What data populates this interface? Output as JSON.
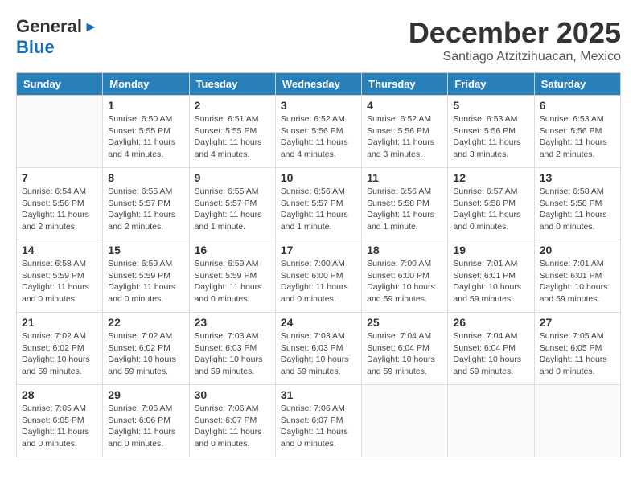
{
  "logo": {
    "general": "General",
    "blue": "Blue"
  },
  "title": {
    "month": "December 2025",
    "location": "Santiago Atzitzihuacan, Mexico"
  },
  "headers": [
    "Sunday",
    "Monday",
    "Tuesday",
    "Wednesday",
    "Thursday",
    "Friday",
    "Saturday"
  ],
  "weeks": [
    [
      {
        "day": "",
        "info": ""
      },
      {
        "day": "1",
        "info": "Sunrise: 6:50 AM\nSunset: 5:55 PM\nDaylight: 11 hours\nand 4 minutes."
      },
      {
        "day": "2",
        "info": "Sunrise: 6:51 AM\nSunset: 5:55 PM\nDaylight: 11 hours\nand 4 minutes."
      },
      {
        "day": "3",
        "info": "Sunrise: 6:52 AM\nSunset: 5:56 PM\nDaylight: 11 hours\nand 4 minutes."
      },
      {
        "day": "4",
        "info": "Sunrise: 6:52 AM\nSunset: 5:56 PM\nDaylight: 11 hours\nand 3 minutes."
      },
      {
        "day": "5",
        "info": "Sunrise: 6:53 AM\nSunset: 5:56 PM\nDaylight: 11 hours\nand 3 minutes."
      },
      {
        "day": "6",
        "info": "Sunrise: 6:53 AM\nSunset: 5:56 PM\nDaylight: 11 hours\nand 2 minutes."
      }
    ],
    [
      {
        "day": "7",
        "info": "Sunrise: 6:54 AM\nSunset: 5:56 PM\nDaylight: 11 hours\nand 2 minutes."
      },
      {
        "day": "8",
        "info": "Sunrise: 6:55 AM\nSunset: 5:57 PM\nDaylight: 11 hours\nand 2 minutes."
      },
      {
        "day": "9",
        "info": "Sunrise: 6:55 AM\nSunset: 5:57 PM\nDaylight: 11 hours\nand 1 minute."
      },
      {
        "day": "10",
        "info": "Sunrise: 6:56 AM\nSunset: 5:57 PM\nDaylight: 11 hours\nand 1 minute."
      },
      {
        "day": "11",
        "info": "Sunrise: 6:56 AM\nSunset: 5:58 PM\nDaylight: 11 hours\nand 1 minute."
      },
      {
        "day": "12",
        "info": "Sunrise: 6:57 AM\nSunset: 5:58 PM\nDaylight: 11 hours\nand 0 minutes."
      },
      {
        "day": "13",
        "info": "Sunrise: 6:58 AM\nSunset: 5:58 PM\nDaylight: 11 hours\nand 0 minutes."
      }
    ],
    [
      {
        "day": "14",
        "info": "Sunrise: 6:58 AM\nSunset: 5:59 PM\nDaylight: 11 hours\nand 0 minutes."
      },
      {
        "day": "15",
        "info": "Sunrise: 6:59 AM\nSunset: 5:59 PM\nDaylight: 11 hours\nand 0 minutes."
      },
      {
        "day": "16",
        "info": "Sunrise: 6:59 AM\nSunset: 5:59 PM\nDaylight: 11 hours\nand 0 minutes."
      },
      {
        "day": "17",
        "info": "Sunrise: 7:00 AM\nSunset: 6:00 PM\nDaylight: 11 hours\nand 0 minutes."
      },
      {
        "day": "18",
        "info": "Sunrise: 7:00 AM\nSunset: 6:00 PM\nDaylight: 10 hours\nand 59 minutes."
      },
      {
        "day": "19",
        "info": "Sunrise: 7:01 AM\nSunset: 6:01 PM\nDaylight: 10 hours\nand 59 minutes."
      },
      {
        "day": "20",
        "info": "Sunrise: 7:01 AM\nSunset: 6:01 PM\nDaylight: 10 hours\nand 59 minutes."
      }
    ],
    [
      {
        "day": "21",
        "info": "Sunrise: 7:02 AM\nSunset: 6:02 PM\nDaylight: 10 hours\nand 59 minutes."
      },
      {
        "day": "22",
        "info": "Sunrise: 7:02 AM\nSunset: 6:02 PM\nDaylight: 10 hours\nand 59 minutes."
      },
      {
        "day": "23",
        "info": "Sunrise: 7:03 AM\nSunset: 6:03 PM\nDaylight: 10 hours\nand 59 minutes."
      },
      {
        "day": "24",
        "info": "Sunrise: 7:03 AM\nSunset: 6:03 PM\nDaylight: 10 hours\nand 59 minutes."
      },
      {
        "day": "25",
        "info": "Sunrise: 7:04 AM\nSunset: 6:04 PM\nDaylight: 10 hours\nand 59 minutes."
      },
      {
        "day": "26",
        "info": "Sunrise: 7:04 AM\nSunset: 6:04 PM\nDaylight: 10 hours\nand 59 minutes."
      },
      {
        "day": "27",
        "info": "Sunrise: 7:05 AM\nSunset: 6:05 PM\nDaylight: 11 hours\nand 0 minutes."
      }
    ],
    [
      {
        "day": "28",
        "info": "Sunrise: 7:05 AM\nSunset: 6:05 PM\nDaylight: 11 hours\nand 0 minutes."
      },
      {
        "day": "29",
        "info": "Sunrise: 7:06 AM\nSunset: 6:06 PM\nDaylight: 11 hours\nand 0 minutes."
      },
      {
        "day": "30",
        "info": "Sunrise: 7:06 AM\nSunset: 6:07 PM\nDaylight: 11 hours\nand 0 minutes."
      },
      {
        "day": "31",
        "info": "Sunrise: 7:06 AM\nSunset: 6:07 PM\nDaylight: 11 hours\nand 0 minutes."
      },
      {
        "day": "",
        "info": ""
      },
      {
        "day": "",
        "info": ""
      },
      {
        "day": "",
        "info": ""
      }
    ]
  ]
}
